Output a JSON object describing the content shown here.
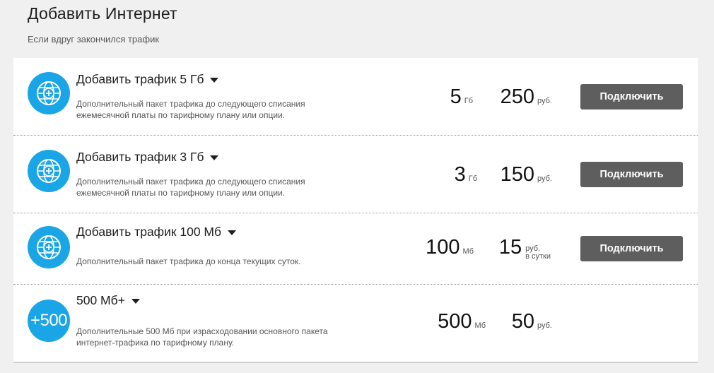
{
  "header": {
    "title": "Добавить Интернет",
    "subtitle": "Если вдруг закончился трафик"
  },
  "colors": {
    "accent": "#1aa6e6",
    "button": "#5e5e5e",
    "background": "#f0f0f0"
  },
  "offers": [
    {
      "icon": "globe-plus-icon",
      "title": "Добавить трафик 5 Гб",
      "description": "Дополнительный пакет трафика до следующего списания ежемесячной платы по тарифному плану или опции.",
      "amount": "5",
      "amount_unit": "Гб",
      "price": "250",
      "price_unit": "руб.",
      "button": "Подключить"
    },
    {
      "icon": "globe-plus-icon",
      "title": "Добавить трафик 3 Гб",
      "description": "Дополнительный пакет трафика до следующего списания ежемесячной платы по тарифному плану или опции.",
      "amount": "3",
      "amount_unit": "Гб",
      "price": "150",
      "price_unit": "руб.",
      "button": "Подключить"
    },
    {
      "icon": "globe-plus-icon",
      "title": "Добавить трафик 100 Мб",
      "description": "Дополнительный пакет трафика до конца текущих суток.",
      "amount": "100",
      "amount_unit": "Мб",
      "price": "15",
      "price_unit": "руб.",
      "price_unit_extra": "в сутки",
      "button": "Подключить"
    },
    {
      "icon": "plus-500-icon",
      "icon_text": "+500",
      "title": "500 Мб+",
      "description": "Дополнительные 500 Мб при израсходовании основного пакета интернет-трафика по тарифному плану.",
      "amount": "500",
      "amount_unit": "Мб",
      "price": "50",
      "price_unit": "руб."
    }
  ]
}
